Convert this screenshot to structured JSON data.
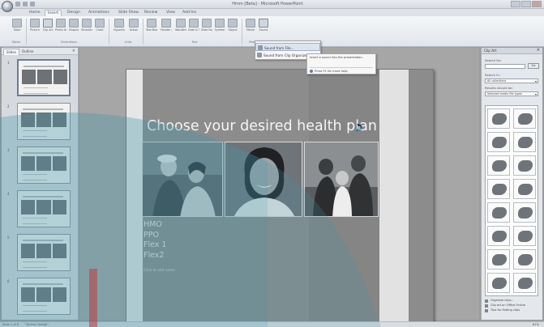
{
  "window": {
    "title": "Hmm [Beta] - Microsoft PowerPoint"
  },
  "ribbon": {
    "tabs": [
      "Home",
      "Insert",
      "Design",
      "Animations",
      "Slide Show",
      "Review",
      "View",
      "Add-Ins"
    ],
    "active_tab": "Insert",
    "buttons": [
      "Table",
      "Picture",
      "Clip Art",
      "Photo Album",
      "Shapes",
      "SmartArt",
      "Chart",
      "Hyperlink",
      "Action",
      "Text Box",
      "Header & Footer",
      "WordArt",
      "Date & Time",
      "Slide Number",
      "Symbol",
      "Object",
      "Movie",
      "Sound"
    ],
    "groups": [
      "Tables",
      "Illustrations",
      "Links",
      "Text",
      "Media Clips"
    ]
  },
  "sound_menu": {
    "items": [
      "Sound from File...",
      "Sound from Clip Organizer..."
    ],
    "tooltip": {
      "description": "Insert a sound into the presentation.",
      "help": "Press F1 for more help."
    }
  },
  "slides_pane": {
    "tabs": [
      "Slides",
      "Outline"
    ],
    "close": "×",
    "slide_numbers": [
      "1",
      "2",
      "3",
      "4",
      "5",
      "6"
    ]
  },
  "slide": {
    "title": "Choose your desired health plan",
    "bullets": [
      "HMO",
      "PPO",
      "Flex 1",
      "Flex2"
    ],
    "notes_placeholder": "Click to add notes"
  },
  "clip_art": {
    "title": "Clip Art",
    "search_label": "Search for:",
    "search_value": "",
    "go_button": "Go",
    "search_in_label": "Search in:",
    "search_in_value": "All collections",
    "results_label": "Results should be:",
    "results_value": "Selected media file types",
    "links": [
      "Organize clips...",
      "Clip art on Office Online",
      "Tips for finding clips"
    ]
  },
  "status": {
    "slide_info": "Slide 1 of 6",
    "theme": "\"Technic Health\"",
    "zoom": "61%"
  }
}
